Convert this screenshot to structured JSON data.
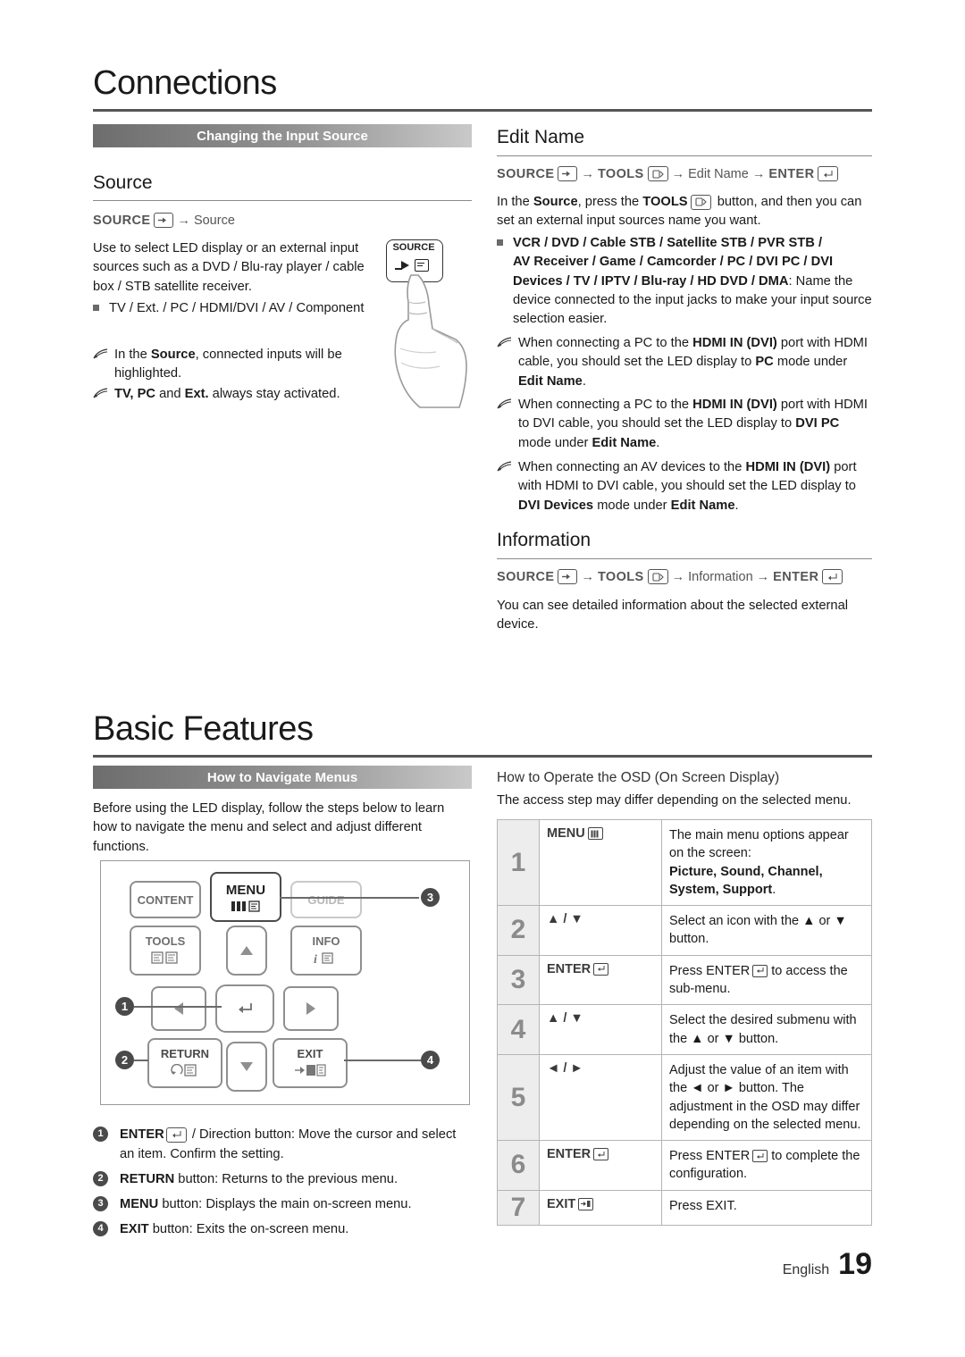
{
  "page": {
    "footer_language": "English",
    "footer_number": "19"
  },
  "connections": {
    "title": "Connections",
    "section_bar": "Changing the Input Source",
    "source": {
      "heading": "Source",
      "path": {
        "k1": "SOURCE",
        "arrow1": "→",
        "k2": "Source"
      },
      "intro": "Use to select LED display or an external input sources such as a DVD / Blu-ray player / cable box / STB satellite receiver.",
      "bullet": "TV / Ext. / PC / HDMI/DVI / AV / Component",
      "note1_a": "In the ",
      "note1_b": "Source",
      "note1_c": ", connected inputs will be highlighted.",
      "note2_a": "TV, PC",
      "note2_b": " and ",
      "note2_c": "Ext.",
      "note2_d": " always stay activated.",
      "remote_button_label": "SOURCE"
    },
    "edit_name": {
      "heading": "Edit Name",
      "path": {
        "k1": "SOURCE",
        "a1": "→",
        "k2": "TOOLS",
        "a2": "→",
        "k3": "Edit Name",
        "a3": "→",
        "k4": "ENTER"
      },
      "intro_a": "In the ",
      "intro_b": "Source",
      "intro_c": ", press the ",
      "intro_d": "TOOLS",
      "intro_e": " button, and then you can set an external input sources name you want.",
      "bullet_line1": "VCR / DVD / Cable STB / Satellite STB / PVR STB /",
      "bullet_line2": "AV Receiver / Game / Camcorder / PC / DVI PC / DVI",
      "bullet_line3": "Devices / TV / IPTV / Blu-ray / HD DVD / DMA",
      "bullet_line3_tail": ": Name the device connected to the input jacks to make your input source selection easier.",
      "note1": {
        "p1": "When connecting a PC to the ",
        "b1": "HDMI IN (DVI)",
        "p2": " port with HDMI cable, you should set the LED display to ",
        "b2": "PC",
        "p3": " mode under ",
        "b3": "Edit Name",
        "p4": "."
      },
      "note2": {
        "p1": "When connecting a PC to the ",
        "b1": "HDMI IN (DVI)",
        "p2": " port with HDMI to DVI cable, you should set the LED display to ",
        "b2": "DVI PC",
        "p3": " mode under ",
        "b3": "Edit Name",
        "p4": "."
      },
      "note3": {
        "p1": "When connecting an AV devices to the ",
        "b1": "HDMI IN (DVI)",
        "p2": " port with HDMI to DVI cable, you should set the LED display to ",
        "b2": "DVI Devices",
        "p3": " mode under ",
        "b3": "Edit Name",
        "p4": "."
      }
    },
    "information": {
      "heading": "Information",
      "path": {
        "k1": "SOURCE",
        "a1": "→",
        "k2": "TOOLS",
        "a2": "→",
        "k3": "Information",
        "a3": "→",
        "k4": "ENTER"
      },
      "body": "You can see detailed information about the selected external device."
    }
  },
  "basic_features": {
    "title": "Basic Features",
    "section_bar": "How to Navigate Menus",
    "intro": "Before using the LED display, follow the steps below to learn how to navigate the menu and select and adjust different functions.",
    "remote": {
      "content": "CONTENT",
      "menu": "MENU",
      "guide": "GUIDE",
      "tools": "TOOLS",
      "info": "INFO",
      "return": "RETURN",
      "exit": "EXIT",
      "callouts": [
        "1",
        "2",
        "3",
        "4"
      ]
    },
    "legend": [
      {
        "num": "1",
        "bold": "ENTER",
        "text": " / Direction button: Move the cursor and select an item. Confirm the setting."
      },
      {
        "num": "2",
        "bold": "RETURN",
        "text": " button: Returns to the previous menu."
      },
      {
        "num": "3",
        "bold": "MENU",
        "text": " button: Displays the main on-screen menu."
      },
      {
        "num": "4",
        "bold": "EXIT",
        "text": " button: Exits the on-screen menu."
      }
    ],
    "osd": {
      "heading": "How to Operate the OSD (On Screen Display)",
      "subheading": "The access step may differ depending on the selected menu.",
      "rows": [
        {
          "num": "1",
          "key": "MENU",
          "key_icon": "menu-icon",
          "desc_pre": "The main menu options appear on the screen:",
          "desc_bold": "Picture, Sound, Channel, System, Support",
          "desc_post": "."
        },
        {
          "num": "2",
          "key": "▲ / ▼",
          "key_icon": "",
          "desc_pre": "Select an icon with the ▲ or ▼ button.",
          "desc_bold": "",
          "desc_post": ""
        },
        {
          "num": "3",
          "key": "ENTER",
          "key_icon": "enter-icon",
          "desc_pre": "Press ENTER",
          "desc_bold": "",
          "desc_post": " to access the sub-menu."
        },
        {
          "num": "4",
          "key": "▲ / ▼",
          "key_icon": "",
          "desc_pre": "Select the desired submenu with the ▲ or ▼ button.",
          "desc_bold": "",
          "desc_post": ""
        },
        {
          "num": "5",
          "key": "◄ / ►",
          "key_icon": "",
          "desc_pre": "Adjust the value of an item with the ◄ or ► button. The adjustment in the OSD may differ depending on the selected menu.",
          "desc_bold": "",
          "desc_post": ""
        },
        {
          "num": "6",
          "key": "ENTER",
          "key_icon": "enter-icon",
          "desc_pre": "Press ENTER",
          "desc_bold": "",
          "desc_post": " to complete the configuration."
        },
        {
          "num": "7",
          "key": "EXIT",
          "key_icon": "exit-icon",
          "desc_pre": "Press EXIT.",
          "desc_bold": "",
          "desc_post": ""
        }
      ]
    }
  }
}
